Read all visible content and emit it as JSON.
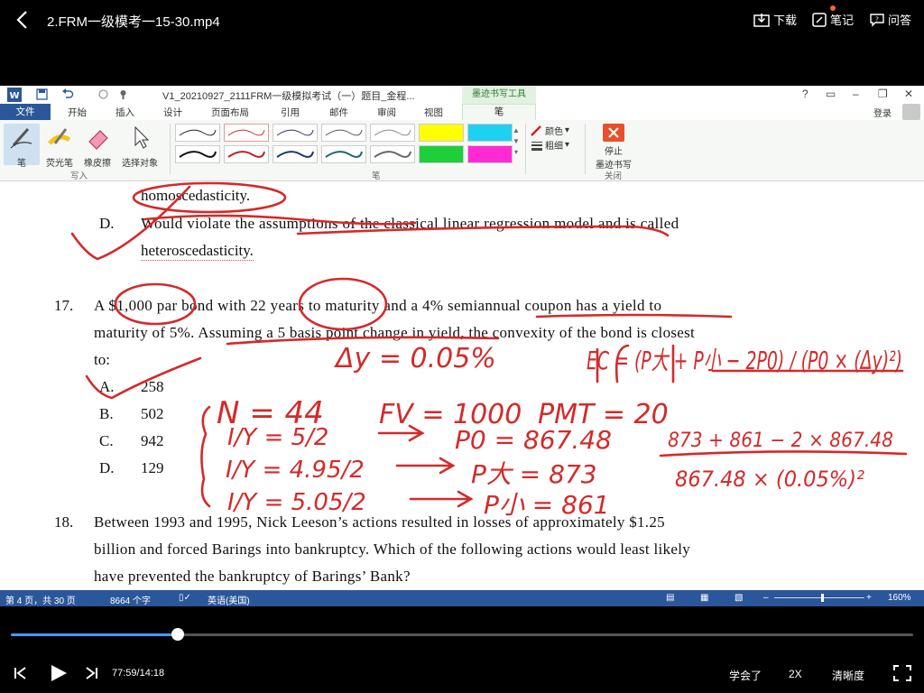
{
  "player_header": {
    "title": "2.FRM一级模考一15-30.mp4",
    "download_label": "下载",
    "notes_label": "笔记",
    "qa_label": "问答"
  },
  "word": {
    "doc_title": "V1_20210927_2111FRM一级模拟考试（一）题目_金程...",
    "context_tab": "墨迹书写工具",
    "tabs": [
      "文件",
      "开始",
      "插入",
      "设计",
      "页面布局",
      "引用",
      "邮件",
      "审阅",
      "视图",
      "笔"
    ],
    "login": "登录",
    "help": "?",
    "ribbon": {
      "pen": "笔",
      "highlighter": "荧光笔",
      "eraser": "橡皮擦",
      "select": "选择对象",
      "group_write": "写入",
      "group_pens": "笔",
      "color": "颜色",
      "thickness": "粗细",
      "stop_line1": "停止",
      "stop_line2": "墨迹书写",
      "group_close": "关闭"
    },
    "status": {
      "page": "第 4 页，共 30 页",
      "words": "8664 个字",
      "lang": "英语(美国)",
      "zoom": "160%"
    }
  },
  "document": {
    "line_c_end": "homoscedasticity.",
    "d_letter": "D.",
    "d_text": "Would violate the assumptions of the classical linear regression model and is called",
    "d_text2": "heteroscedasticity.",
    "q17_num": "17.",
    "q17_l1": "A $1,000 par bond with 22 years to maturity and a 4% semiannual coupon has a yield to",
    "q17_l2": "maturity of 5%. Assuming a 5 basis point change in yield, the convexity of the bond is closest",
    "q17_l3": "to:",
    "options": [
      {
        "letter": "A.",
        "value": "258"
      },
      {
        "letter": "B.",
        "value": "502"
      },
      {
        "letter": "C.",
        "value": "942"
      },
      {
        "letter": "D.",
        "value": "129"
      }
    ],
    "q18_num": "18.",
    "q18_l1": "Between 1993 and 1995, Nick Leeson’s actions resulted in losses of approximately $1.25",
    "q18_l2": "billion and forced Barings into bankruptcy. Which of the following actions would least likely",
    "q18_l3": "have prevented the bankruptcy of Barings’ Bank?"
  },
  "ink_notes": {
    "dy": "Δy = 0.05%",
    "ec": "EC = (P大 + P小 − 2P0) / (P0 × (Δy)²)",
    "n": "N = 44",
    "fv": "FV = 1000",
    "pmt": "PMT = 20",
    "iy1": "I/Y = 5/2",
    "iy2": "I/Y = 4.95/2",
    "iy3": "I/Y = 5.05/2",
    "p0": "P0 = 867.48",
    "pbig": "P大 = 873",
    "psmall": "P小 = 861",
    "calc_num": "873 + 861 − 2 × 867.48",
    "calc_den": "867.48 × (0.05%)²"
  },
  "player": {
    "time": "77:59/14:18",
    "progress": 0.185,
    "learned": "学会了",
    "speed": "2X",
    "quality": "清晰度"
  }
}
